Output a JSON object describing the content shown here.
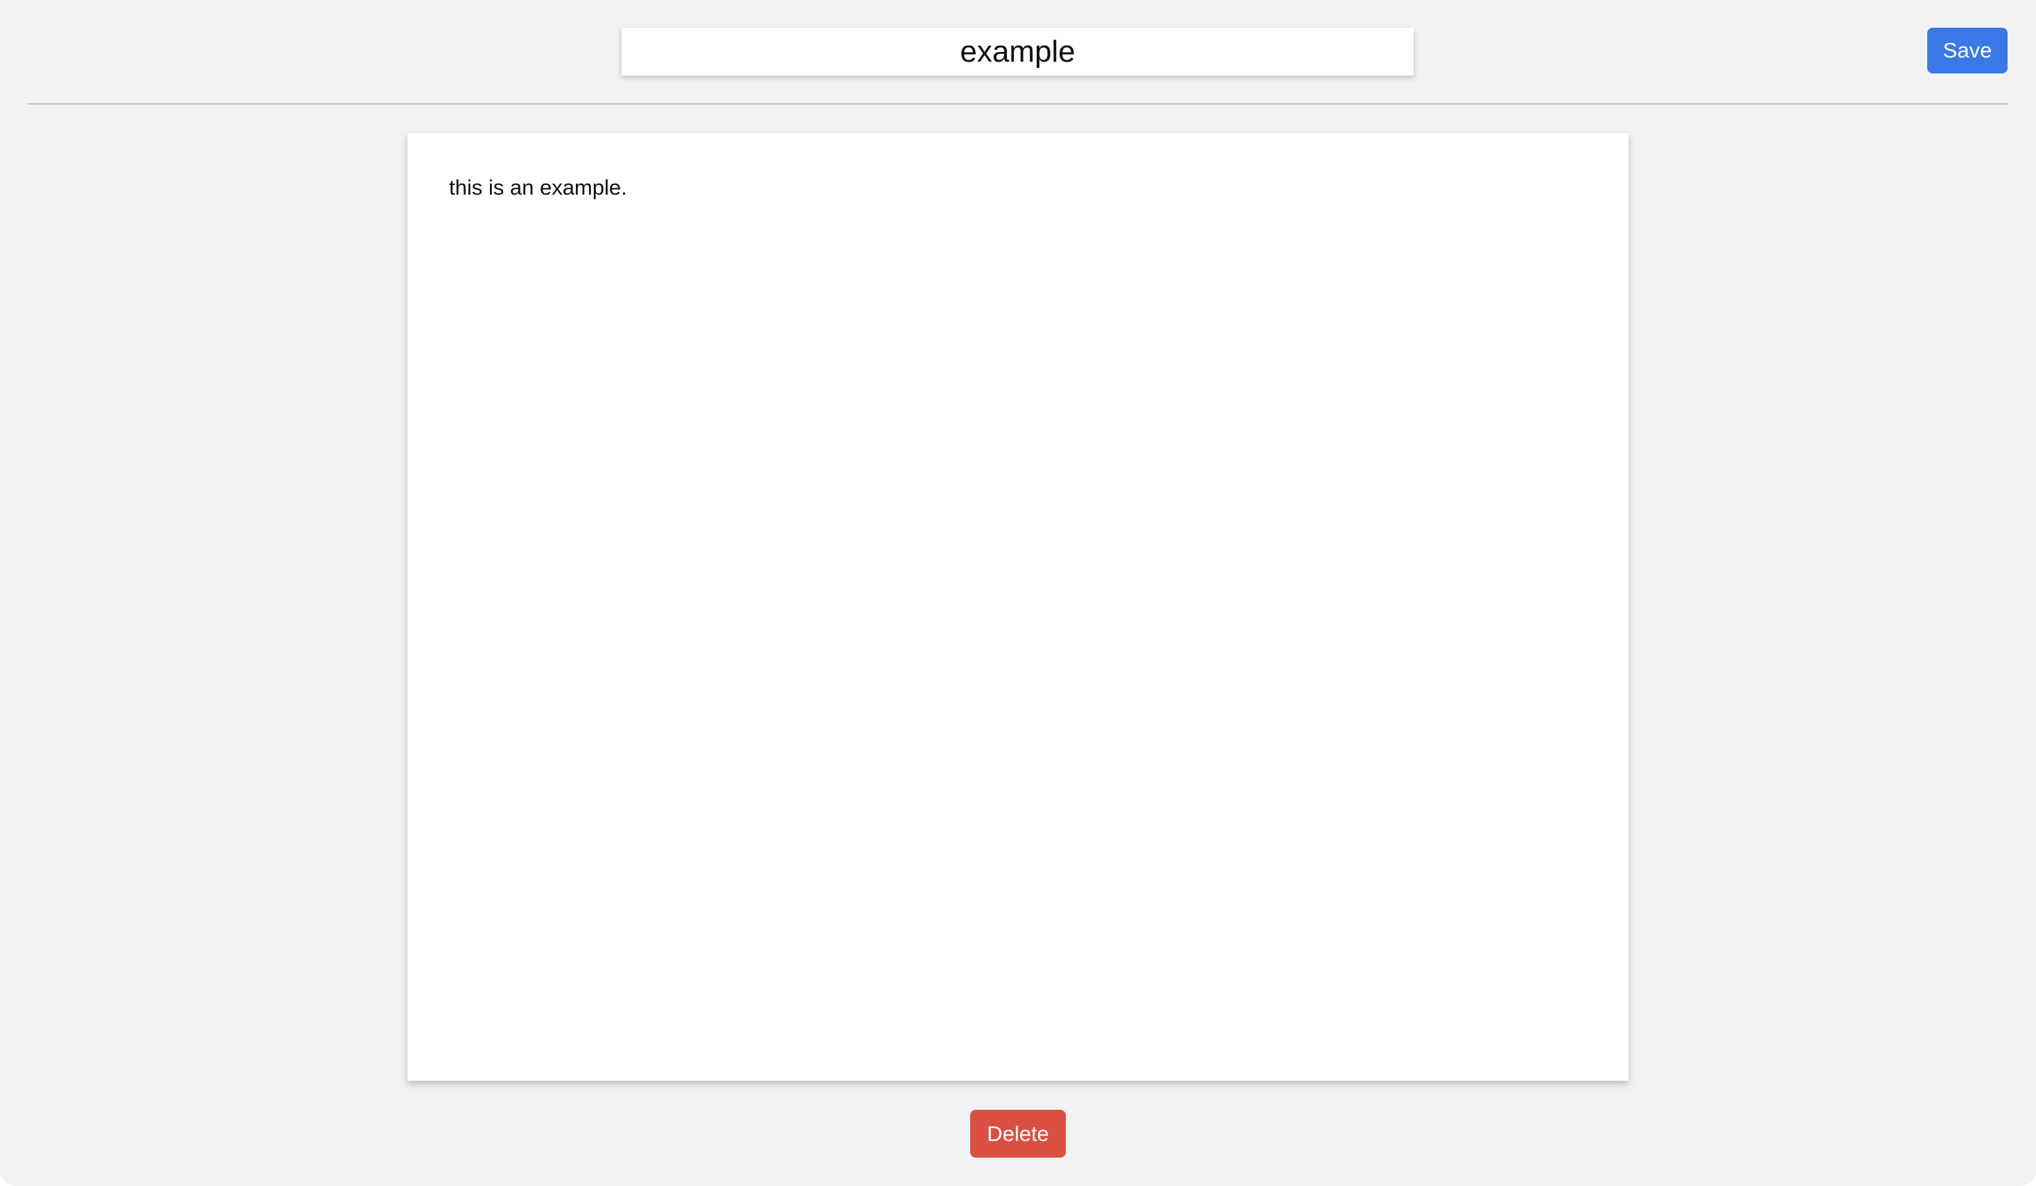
{
  "note": {
    "title": "example",
    "body": "this is an example."
  },
  "toolbar": {
    "save_label": "Save"
  },
  "footer": {
    "delete_label": "Delete"
  },
  "colors": {
    "background": "#f1f2f4",
    "save_button": "#3b78e7",
    "delete_button": "#dc4f43",
    "card": "#ffffff",
    "divider": "#c3c4c7"
  }
}
